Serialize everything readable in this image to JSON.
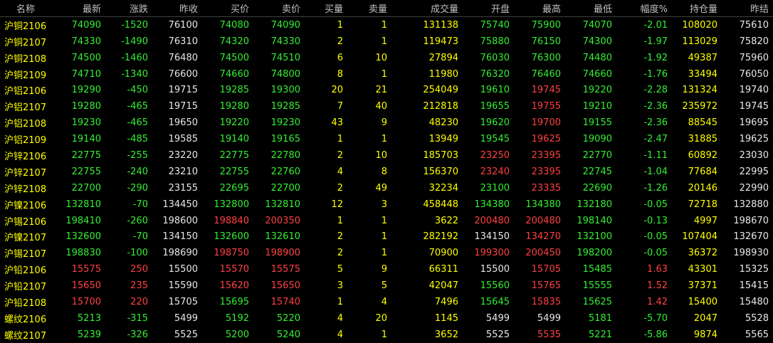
{
  "headers": [
    "名称",
    "最新",
    "涨跌",
    "昨收",
    "买价",
    "卖价",
    "买量",
    "卖量",
    "成交量",
    "开盘",
    "最高",
    "最低",
    "幅度%",
    "持仓量",
    "昨结"
  ],
  "colors": {
    "up": "#ff4040",
    "down": "#33ee33",
    "flat": "#e8e8e8",
    "yellow": "#ffff00",
    "header": "#c0c0c0"
  },
  "rows": [
    {
      "name": "沪铜2106",
      "last": "74090",
      "chg": "-1520",
      "prev": "76100",
      "bid": "74080",
      "ask": "74090",
      "bidv": "1",
      "askv": "1",
      "vol": "131138",
      "open": "75740",
      "high": "75900",
      "low": "74070",
      "pct": "-2.01",
      "oi": "108020",
      "settle": "75610"
    },
    {
      "name": "沪铜2107",
      "last": "74330",
      "chg": "-1490",
      "prev": "76310",
      "bid": "74320",
      "ask": "74330",
      "bidv": "2",
      "askv": "1",
      "vol": "119473",
      "open": "75880",
      "high": "76150",
      "low": "74300",
      "pct": "-1.97",
      "oi": "113029",
      "settle": "75820"
    },
    {
      "name": "沪铜2108",
      "last": "74500",
      "chg": "-1460",
      "prev": "76480",
      "bid": "74500",
      "ask": "74510",
      "bidv": "6",
      "askv": "10",
      "vol": "27894",
      "open": "76030",
      "high": "76300",
      "low": "74480",
      "pct": "-1.92",
      "oi": "49387",
      "settle": "75960"
    },
    {
      "name": "沪铜2109",
      "last": "74710",
      "chg": "-1340",
      "prev": "76600",
      "bid": "74660",
      "ask": "74800",
      "bidv": "8",
      "askv": "1",
      "vol": "11980",
      "open": "76320",
      "high": "76460",
      "low": "74660",
      "pct": "-1.76",
      "oi": "33494",
      "settle": "76050"
    },
    {
      "name": "沪铝2106",
      "last": "19290",
      "chg": "-450",
      "prev": "19715",
      "bid": "19285",
      "ask": "19300",
      "bidv": "20",
      "askv": "21",
      "vol": "254049",
      "open": "19610",
      "high": "19745",
      "low": "19220",
      "pct": "-2.28",
      "oi": "131324",
      "settle": "19740"
    },
    {
      "name": "沪铝2107",
      "last": "19280",
      "chg": "-465",
      "prev": "19715",
      "bid": "19280",
      "ask": "19285",
      "bidv": "7",
      "askv": "40",
      "vol": "212818",
      "open": "19655",
      "high": "19755",
      "low": "19210",
      "pct": "-2.36",
      "oi": "235972",
      "settle": "19745"
    },
    {
      "name": "沪铝2108",
      "last": "19230",
      "chg": "-465",
      "prev": "19650",
      "bid": "19220",
      "ask": "19230",
      "bidv": "43",
      "askv": "9",
      "vol": "48230",
      "open": "19620",
      "high": "19700",
      "low": "19155",
      "pct": "-2.36",
      "oi": "88545",
      "settle": "19695"
    },
    {
      "name": "沪铝2109",
      "last": "19140",
      "chg": "-485",
      "prev": "19585",
      "bid": "19140",
      "ask": "19165",
      "bidv": "1",
      "askv": "1",
      "vol": "13949",
      "open": "19545",
      "high": "19625",
      "low": "19090",
      "pct": "-2.47",
      "oi": "31885",
      "settle": "19625"
    },
    {
      "name": "沪锌2106",
      "last": "22775",
      "chg": "-255",
      "prev": "23220",
      "bid": "22775",
      "ask": "22780",
      "bidv": "2",
      "askv": "10",
      "vol": "185703",
      "open": "23250",
      "high": "23395",
      "low": "22770",
      "pct": "-1.11",
      "oi": "60892",
      "settle": "23030"
    },
    {
      "name": "沪锌2107",
      "last": "22755",
      "chg": "-240",
      "prev": "23210",
      "bid": "22755",
      "ask": "22760",
      "bidv": "4",
      "askv": "8",
      "vol": "156370",
      "open": "23240",
      "high": "23395",
      "low": "22745",
      "pct": "-1.04",
      "oi": "77684",
      "settle": "22995"
    },
    {
      "name": "沪锌2108",
      "last": "22700",
      "chg": "-290",
      "prev": "23155",
      "bid": "22695",
      "ask": "22700",
      "bidv": "2",
      "askv": "49",
      "vol": "32234",
      "open": "23100",
      "high": "23335",
      "low": "22690",
      "pct": "-1.26",
      "oi": "20146",
      "settle": "22990"
    },
    {
      "name": "沪镍2106",
      "last": "132810",
      "chg": "-70",
      "prev": "134450",
      "bid": "132800",
      "ask": "132810",
      "bidv": "12",
      "askv": "3",
      "vol": "458448",
      "open": "134380",
      "high": "134380",
      "low": "132180",
      "pct": "-0.05",
      "oi": "72718",
      "settle": "132880"
    },
    {
      "name": "沪锡2106",
      "last": "198410",
      "chg": "-260",
      "prev": "198600",
      "bid": "198840",
      "ask": "200350",
      "bidv": "1",
      "askv": "1",
      "vol": "3622",
      "open": "200480",
      "high": "200480",
      "low": "198140",
      "pct": "-0.13",
      "oi": "4997",
      "settle": "198670"
    },
    {
      "name": "沪镍2107",
      "last": "132600",
      "chg": "-70",
      "prev": "134150",
      "bid": "132600",
      "ask": "132610",
      "bidv": "2",
      "askv": "1",
      "vol": "282192",
      "open": "134150",
      "high": "134270",
      "low": "132100",
      "pct": "-0.05",
      "oi": "107404",
      "settle": "132670"
    },
    {
      "name": "沪锡2107",
      "last": "198830",
      "chg": "-100",
      "prev": "198690",
      "bid": "198750",
      "ask": "198900",
      "bidv": "2",
      "askv": "1",
      "vol": "70900",
      "open": "199300",
      "high": "200450",
      "low": "198200",
      "pct": "-0.05",
      "oi": "36372",
      "settle": "198930"
    },
    {
      "name": "沪铅2106",
      "last": "15575",
      "chg": "250",
      "prev": "15500",
      "bid": "15570",
      "ask": "15575",
      "bidv": "5",
      "askv": "9",
      "vol": "66311",
      "open": "15500",
      "high": "15705",
      "low": "15485",
      "pct": "1.63",
      "oi": "43301",
      "settle": "15325"
    },
    {
      "name": "沪铅2107",
      "last": "15650",
      "chg": "235",
      "prev": "15590",
      "bid": "15620",
      "ask": "15650",
      "bidv": "3",
      "askv": "5",
      "vol": "42047",
      "open": "15560",
      "high": "15765",
      "low": "15555",
      "pct": "1.52",
      "oi": "37371",
      "settle": "15415"
    },
    {
      "name": "沪铅2108",
      "last": "15700",
      "chg": "220",
      "prev": "15705",
      "bid": "15695",
      "ask": "15740",
      "bidv": "1",
      "askv": "4",
      "vol": "7496",
      "open": "15645",
      "high": "15835",
      "low": "15625",
      "pct": "1.42",
      "oi": "15400",
      "settle": "15480"
    },
    {
      "name": "螺纹2106",
      "last": "5213",
      "chg": "-315",
      "prev": "5499",
      "bid": "5192",
      "ask": "5220",
      "bidv": "4",
      "askv": "20",
      "vol": "1145",
      "open": "5499",
      "high": "5499",
      "low": "5181",
      "pct": "-5.70",
      "oi": "2047",
      "settle": "5528"
    },
    {
      "name": "螺纹2107",
      "last": "5239",
      "chg": "-326",
      "prev": "5525",
      "bid": "5200",
      "ask": "5240",
      "bidv": "4",
      "askv": "1",
      "vol": "3652",
      "open": "5525",
      "high": "5535",
      "low": "5221",
      "pct": "-5.86",
      "oi": "9874",
      "settle": "5565"
    }
  ]
}
